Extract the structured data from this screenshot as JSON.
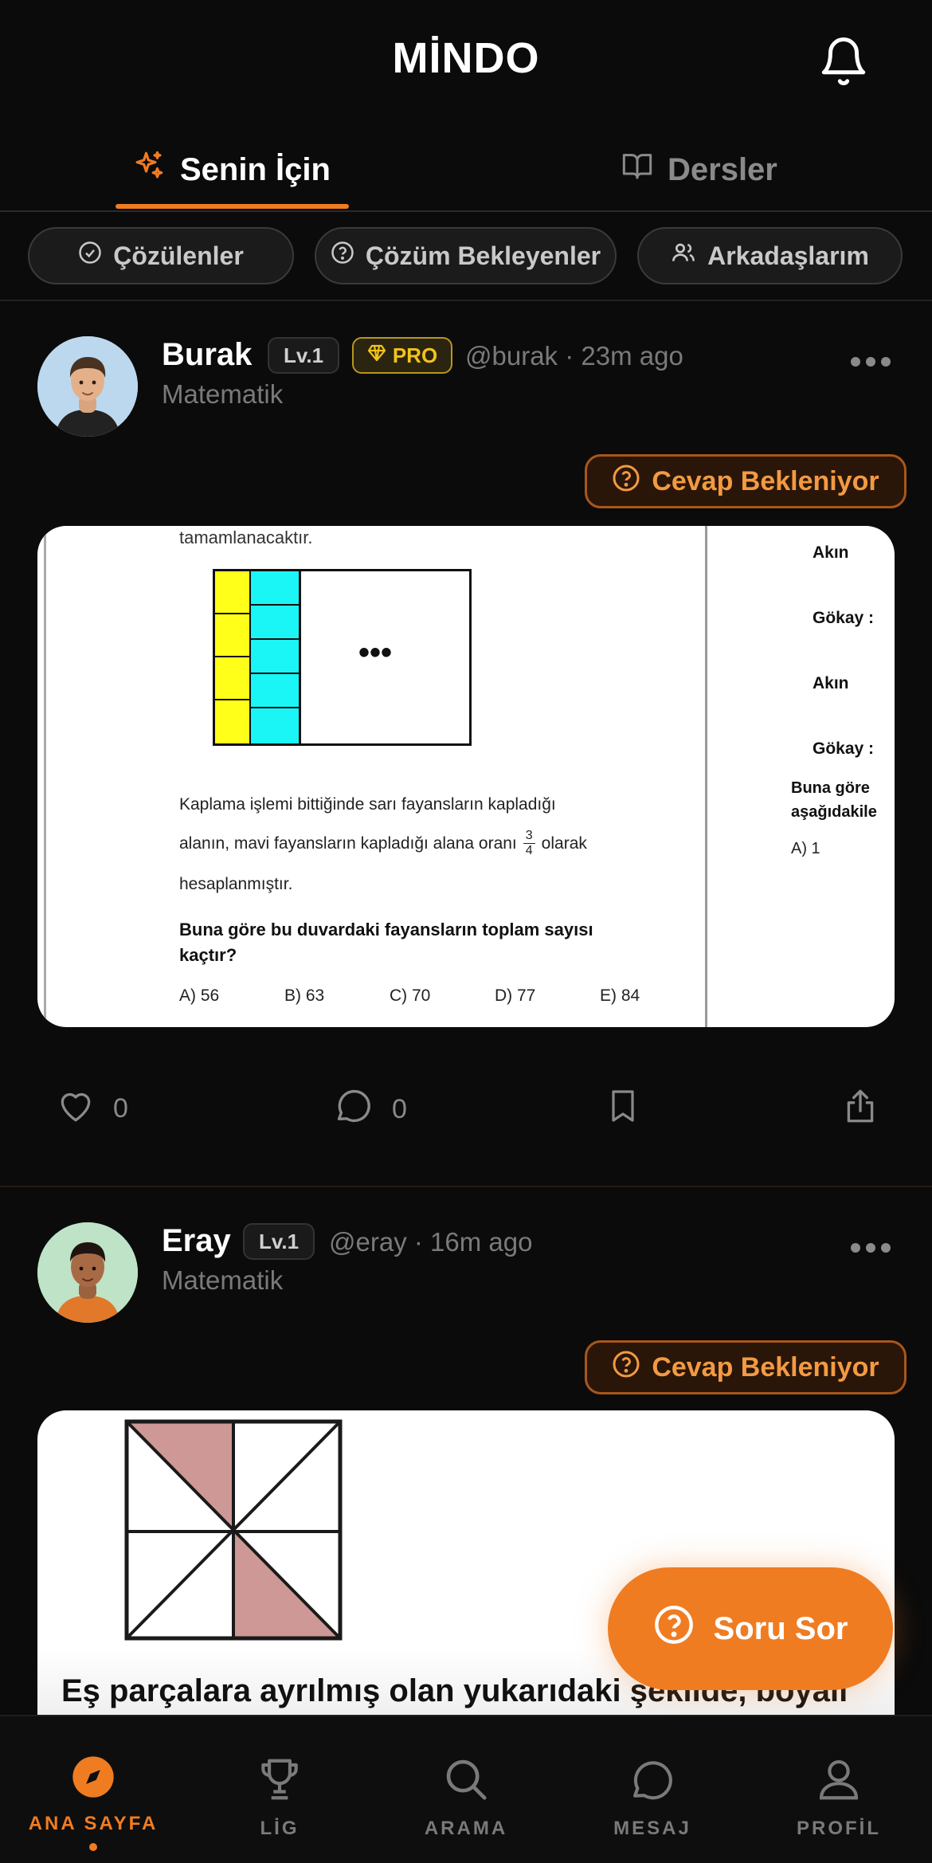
{
  "app": {
    "title": "MİNDO"
  },
  "tabs": [
    {
      "label": "Senin İçin",
      "icon": "sparkles-icon",
      "active": true
    },
    {
      "label": "Dersler",
      "icon": "book-icon",
      "active": false
    }
  ],
  "filters": [
    {
      "label": "Çözülenler",
      "icon": "check-circle-icon"
    },
    {
      "label": "Çözüm Bekleyenler",
      "icon": "question-circle-icon"
    },
    {
      "label": "Arkadaşlarım",
      "icon": "users-icon"
    }
  ],
  "posts": [
    {
      "user": "Burak",
      "level": "Lv.1",
      "pro": "PRO",
      "handle": "@burak · 23m ago",
      "subject": "Matematik",
      "status": "Cevap Bekleniyor",
      "likes": "0",
      "comments": "0",
      "question": {
        "top_text": "tamamlanacaktır.",
        "body_line1": "Kaplama işlemi bittiğinde sarı fayansların kapladığı",
        "body_line2a": "alanın, mavi fayansların kapladığı alana oranı",
        "frac_num": "3",
        "frac_den": "4",
        "body_line2b": "olarak",
        "body_line3": "hesaplanmıştır.",
        "q_bold1": "Buna göre bu duvardaki fayansların toplam sayısı",
        "q_bold2": "kaçtır?",
        "options": [
          "A) 56",
          "B) 63",
          "C) 70",
          "D) 77",
          "E) 84"
        ],
        "dots": "•••",
        "side": [
          "Akın",
          "Gökay :",
          "Akın",
          "Gökay :"
        ],
        "side_q1": "Buna göre",
        "side_q2": "aşağıdakile",
        "side_opt": "A)  1"
      }
    },
    {
      "user": "Eray",
      "level": "Lv.1",
      "handle": "@eray · 16m ago",
      "subject": "Matematik",
      "status": "Cevap Bekleniyor",
      "question": {
        "text": "Eş parçalara ayrılmış olan yukarıdaki şekilde, boyalı"
      }
    }
  ],
  "fab": {
    "label": "Soru Sor"
  },
  "nav": [
    {
      "label": "ANA SAYFA",
      "icon": "compass-icon",
      "active": true
    },
    {
      "label": "LİG",
      "icon": "trophy-icon",
      "active": false
    },
    {
      "label": "ARAMA",
      "icon": "search-icon",
      "active": false
    },
    {
      "label": "MESAJ",
      "icon": "chat-icon",
      "active": false
    },
    {
      "label": "PROFİL",
      "icon": "user-icon",
      "active": false
    }
  ],
  "colors": {
    "accent": "#f07c22",
    "background": "#0b0b0b",
    "pro_gold": "#f2c418"
  }
}
